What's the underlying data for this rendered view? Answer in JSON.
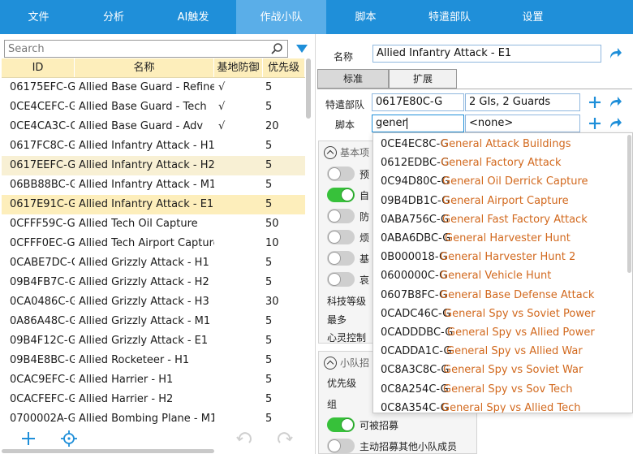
{
  "nav": {
    "tabs": [
      {
        "label": "文件"
      },
      {
        "label": "分析"
      },
      {
        "label": "AI触发"
      },
      {
        "label": "作战小队"
      },
      {
        "label": "脚本"
      },
      {
        "label": "特遣部队"
      },
      {
        "label": "设置"
      }
    ],
    "active_tab": "作战小队",
    "active_color": "#5aaee8",
    "bar_color": "#1f8fd9"
  },
  "left": {
    "search_placeholder": "Search",
    "columns": [
      "ID",
      "名称",
      "基地防御",
      "优先级"
    ],
    "rows": [
      {
        "id": "06175EFC-G",
        "name": "Allied Base Guard - Refine",
        "base": "√",
        "pri": "5"
      },
      {
        "id": "0CE4CEFC-G",
        "name": "Allied Base Guard - Tech",
        "base": "√",
        "pri": "5"
      },
      {
        "id": "0CE4CA3C-G",
        "name": "Allied Base Guard - Adv",
        "base": "√",
        "pri": "20"
      },
      {
        "id": "0617FC8C-G",
        "name": "Allied Infantry Attack - H1",
        "base": "",
        "pri": "5"
      },
      {
        "id": "0617EEFC-G",
        "name": "Allied Infantry Attack - H2",
        "base": "",
        "pri": "5"
      },
      {
        "id": "06BB88BC-G",
        "name": "Allied Infantry Attack - M1",
        "base": "",
        "pri": "5"
      },
      {
        "id": "0617E91C-G",
        "name": "Allied Infantry Attack - E1",
        "base": "",
        "pri": "5"
      },
      {
        "id": "0CFFF59C-G",
        "name": "Allied Tech Oil Capture",
        "base": "",
        "pri": "50"
      },
      {
        "id": "0CFFF0EC-G",
        "name": "Allied Tech Airport Capture",
        "base": "",
        "pri": "10"
      },
      {
        "id": "0CABE7DC-G",
        "name": "Allied Grizzly Attack - H1",
        "base": "",
        "pri": "5"
      },
      {
        "id": "09B4FB7C-G",
        "name": "Allied Grizzly Attack - H2",
        "base": "",
        "pri": "5"
      },
      {
        "id": "0CA0486C-G",
        "name": "Allied Grizzly Attack - H3",
        "base": "",
        "pri": "30"
      },
      {
        "id": "0A86A48C-G",
        "name": "Allied Grizzly Attack - M1",
        "base": "",
        "pri": "5"
      },
      {
        "id": "09B4F12C-G",
        "name": "Allied Grizzly Attack - E1",
        "base": "",
        "pri": "5"
      },
      {
        "id": "09B4E8BC-G",
        "name": "Allied Rocketeer - H1",
        "base": "",
        "pri": "5"
      },
      {
        "id": "0CAC9EFC-G",
        "name": "Allied Harrier - H1",
        "base": "",
        "pri": "5"
      },
      {
        "id": "0CACFEFC-G",
        "name": "Allied Harrier - H2",
        "base": "",
        "pri": "5"
      },
      {
        "id": "0700002A-G",
        "name": "Allied Bombing Plane - M1",
        "base": "",
        "pri": "5"
      }
    ],
    "selected_row": 6,
    "hover_row": 4
  },
  "right": {
    "name_label": "名称",
    "name_value": "Allied Infantry Attack - E1",
    "subtabs": [
      "标准",
      "扩展"
    ],
    "taskforce_label": "特遣部队",
    "taskforce_id": "0617E80C-G",
    "taskforce_desc": "2 GIs, 2 Guards",
    "script_label": "脚本",
    "script_input": "gener",
    "script_value": "<none>",
    "basic_group_label": "基本项",
    "toggles": [
      {
        "label": "预",
        "on": false
      },
      {
        "label": "自",
        "on": true
      },
      {
        "label": "防",
        "on": false
      },
      {
        "label": "烦",
        "on": false
      },
      {
        "label": "基",
        "on": false
      },
      {
        "label": "哀",
        "on": false
      }
    ],
    "tech_level_label": "科技等级",
    "max_label": "最多",
    "psi_label": "心灵控制",
    "recruit_group_label": "小队招",
    "priority_label": "优先级",
    "group_label": "组",
    "recruitable_label": "可被招募",
    "recruitable_on": true,
    "auto_recruit_label": "主动招募其他小队成员"
  },
  "dropdown": {
    "options": [
      {
        "id": "0CE4EC8C-G",
        "name": "General Attack Buildings"
      },
      {
        "id": "0612EDBC-G",
        "name": "General Factory Attack"
      },
      {
        "id": "0C94D80C-G",
        "name": "General Oil Derrick Capture"
      },
      {
        "id": "09B4DB1C-G",
        "name": "General Airport Capture"
      },
      {
        "id": "0ABA756C-G",
        "name": "General Fast Factory Attack"
      },
      {
        "id": "0ABA6DBC-G",
        "name": "General Harvester Hunt"
      },
      {
        "id": "0B000018-G",
        "name": "General Harvester Hunt 2"
      },
      {
        "id": "0600000C-G",
        "name": "General Vehicle Hunt"
      },
      {
        "id": "0607B8FC-G",
        "name": "General Base Defense Attack"
      },
      {
        "id": "0CADC46C-G",
        "name": "General Spy vs Soviet Power"
      },
      {
        "id": "0CADDDBC-G",
        "name": "General Spy vs Allied Power"
      },
      {
        "id": "0CADDA1C-G",
        "name": "General Spy vs Allied War"
      },
      {
        "id": "0C8A3C8C-G",
        "name": "General Spy vs Soviet War"
      },
      {
        "id": "0C8A254C-G",
        "name": "General Spy vs Sov Tech"
      },
      {
        "id": "0C8A354C-G",
        "name": "General Spy vs Allied Tech"
      }
    ],
    "name_color": "#d2691e"
  },
  "icons": {
    "search": "search-icon",
    "filter": "filter-icon",
    "add": "plus-icon",
    "locate": "crosshair-icon",
    "undo": "undo-icon",
    "redo": "redo-icon",
    "jump": "share-arrow-icon",
    "accent": "#1f8fd9"
  }
}
